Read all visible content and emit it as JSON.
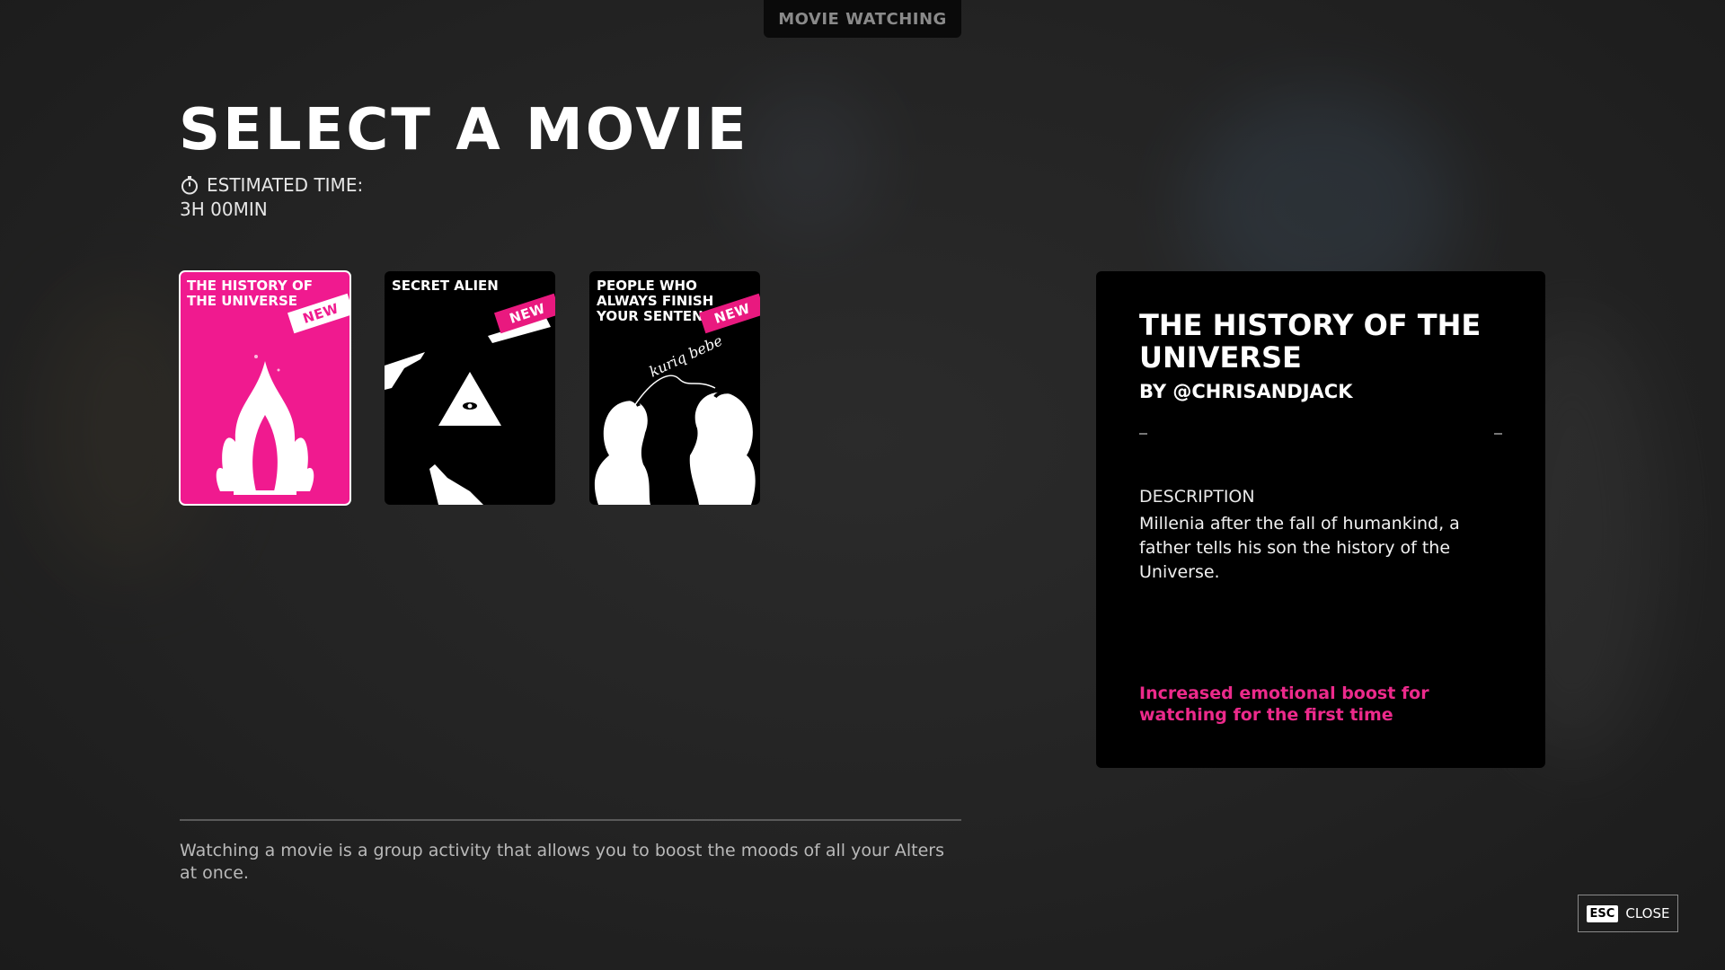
{
  "top_tab": {
    "label": "MOVIE WATCHING"
  },
  "header": {
    "title": "SELECT A MOVIE",
    "estimated_label": "ESTIMATED TIME:",
    "estimated_value": "3H 00MIN",
    "timer_icon": "stopwatch-icon"
  },
  "movies": [
    {
      "title": "THE HISTORY OF THE UNIVERSE",
      "badge": "NEW",
      "selected": true,
      "color": "#f01a8f"
    },
    {
      "title": "SECRET ALIEN",
      "badge": "NEW",
      "selected": false,
      "color": "#000000"
    },
    {
      "title": "PEOPLE WHO ALWAYS FINISH YOUR SENTENCES",
      "badge": "NEW",
      "selected": false,
      "color": "#000000"
    }
  ],
  "poster_art": {
    "card3_handwriting": "kuriq bebe"
  },
  "detail": {
    "title": "THE HISTORY OF THE UNIVERSE",
    "author": "BY @CHRISANDJACK",
    "description_heading": "DESCRIPTION",
    "description": "Millenia after the fall of humankind, a father tells his son the history of the Universe.",
    "boost_text": "Increased emotional boost for watching for the first time"
  },
  "footer": {
    "text": "Watching a movie is a group activity that allows you to boost the moods of all your Alters at once."
  },
  "close_button": {
    "key": "ESC",
    "label": "CLOSE"
  },
  "colors": {
    "accent_pink": "#e9197f",
    "panel_bg": "#000000"
  }
}
